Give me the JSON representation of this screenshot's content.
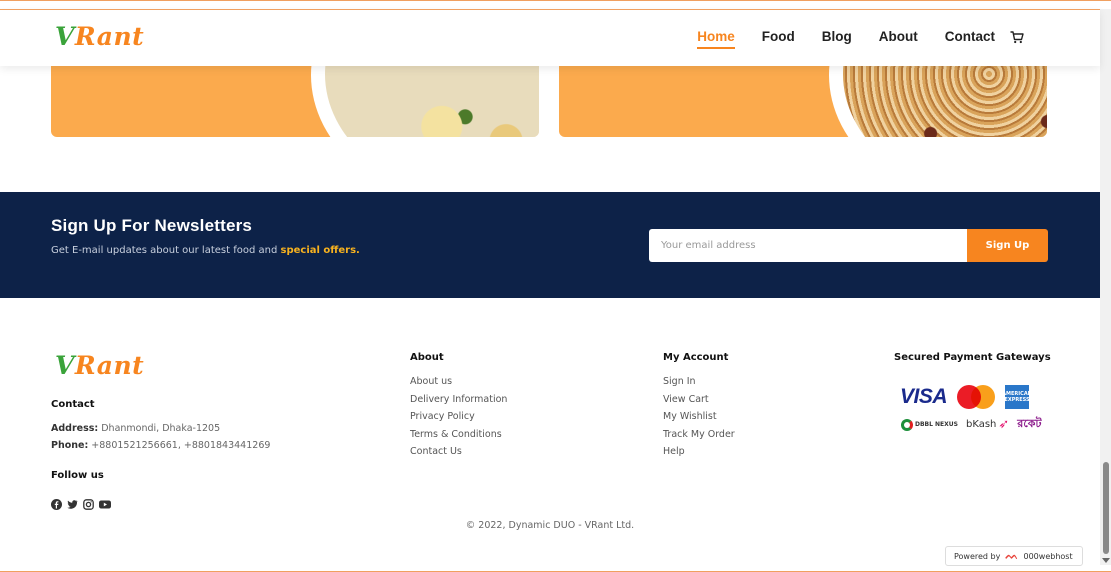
{
  "brand": {
    "logo_v": "V",
    "logo_rest": "Rant",
    "logo_colors": {
      "v": "#3aa33a",
      "rest": "#f7851f"
    }
  },
  "nav": {
    "items": [
      {
        "label": "Home",
        "active": true
      },
      {
        "label": "Food",
        "active": false
      },
      {
        "label": "Blog",
        "active": false
      },
      {
        "label": "About",
        "active": false
      },
      {
        "label": "Contact",
        "active": false
      }
    ],
    "cart_icon": "cart-icon"
  },
  "newsletter": {
    "title": "Sign Up For Newsletters",
    "subtitle": "Get E-mail updates about our latest food and",
    "subtitle_highlight": "special offers.",
    "email_placeholder": "Your email address",
    "button_label": "Sign Up"
  },
  "footer": {
    "contact": {
      "heading": "Contact",
      "address_label": "Address:",
      "address_value": "Dhanmondi, Dhaka-1205",
      "phone_label": "Phone:",
      "phone_value": "+8801521256661, +8801843441269",
      "follow_heading": "Follow us",
      "social_icons": [
        "facebook-icon",
        "twitter-icon",
        "instagram-icon",
        "youtube-icon"
      ]
    },
    "about": {
      "heading": "About",
      "links": [
        "About us",
        "Delivery Information",
        "Privacy Policy",
        "Terms & Conditions",
        "Contact Us"
      ]
    },
    "account": {
      "heading": "My Account",
      "links": [
        "Sign In",
        "View Cart",
        "My Wishlist",
        "Track My Order",
        "Help"
      ]
    },
    "payment": {
      "heading": "Secured Payment Gateways",
      "visa": "VISA",
      "amex": "AMERICAN EXPRESS",
      "dbbl": "DBBL NEXUS",
      "bkash": "bKash",
      "rocket": "রকেট"
    },
    "copyright": "© 2022, Dynamic DUO - VRant Ltd."
  },
  "powered_by": {
    "label": "Powered by",
    "brand": "000webhost"
  },
  "colors": {
    "accent": "#f7851f",
    "navy": "#0d2248",
    "banner": "#fbaa4d"
  }
}
